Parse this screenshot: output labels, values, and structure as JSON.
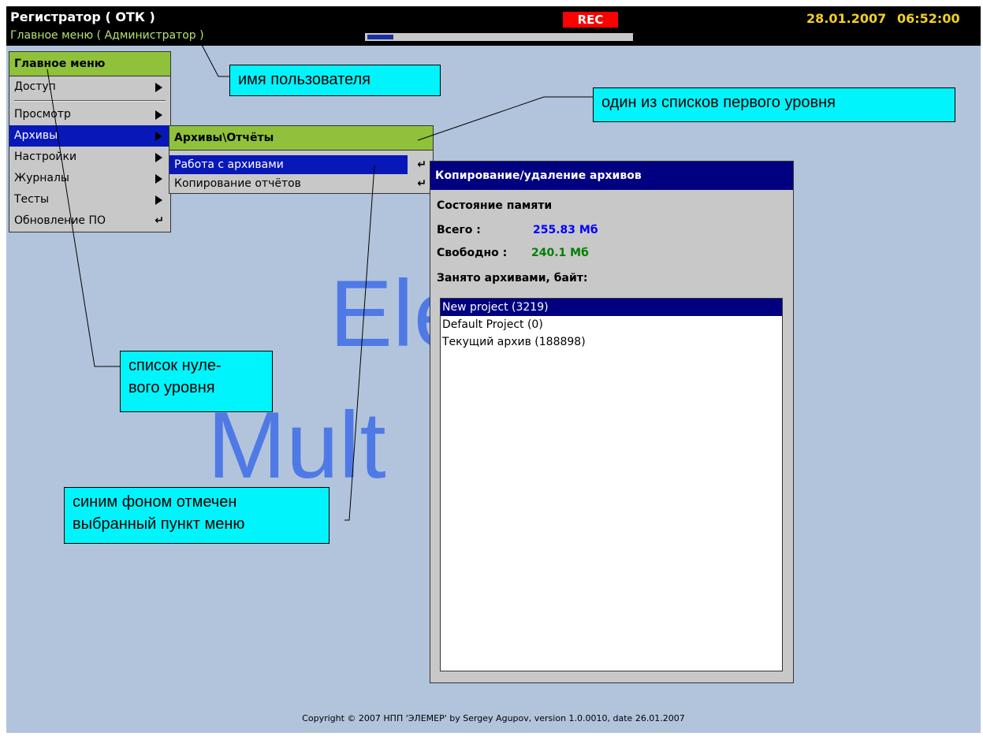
{
  "topbar": {
    "title": "Регистратор ( ОТК )",
    "subtitle": "Главное меню ( Администратор )",
    "rec_badge": "REC",
    "date": "28.01.2007",
    "time": "06:52:00",
    "progress": 0.1
  },
  "watermark": {
    "line1": "Ele",
    "line2": "Mult"
  },
  "main_menu": {
    "header": "Главное меню",
    "items": [
      {
        "label": "Доступ",
        "type": "submenu"
      },
      {
        "label": "Просмотр",
        "type": "submenu"
      },
      {
        "label": "Архивы",
        "type": "submenu",
        "selected": true
      },
      {
        "label": "Настройки",
        "type": "submenu"
      },
      {
        "label": "Журналы",
        "type": "submenu"
      },
      {
        "label": "Тесты",
        "type": "submenu"
      },
      {
        "label": "Обновление ПО",
        "type": "action"
      }
    ]
  },
  "archives_menu": {
    "header": "Архивы\\Отчёты",
    "items": [
      {
        "label": "Работа с архивами",
        "selected": true
      },
      {
        "label": "Копирование отчётов"
      }
    ]
  },
  "dialog": {
    "title": "Копирование/удаление архивов",
    "memory_state_label": "Состояние памяти",
    "total_label": "Всего :",
    "total_value": "255.83 Мб",
    "free_label": "Свободно :",
    "free_value": "240.1 Мб",
    "occupied_label": "Занято архивами, байт:",
    "archives": [
      "New project (3219)",
      "Default Project (0)",
      "Текущий архив (188898)"
    ],
    "colors": {
      "total": "#0000ff",
      "free": "#008000"
    }
  },
  "callouts": {
    "username": "имя пользователя",
    "first_level": "один из списков первого уровня",
    "zero_level": "список нуле-\nвого уровня",
    "selected_item": "синим фоном отмечен\nвыбранный пункт меню"
  },
  "copyright": "Copyright © 2007 НПП 'ЭЛЕМЕР' by Sergey Agupov, version 1.0.0010, date 26.01.2007",
  "icons": {
    "submenu": "triangle-right-icon",
    "enter": "enter-icon"
  }
}
